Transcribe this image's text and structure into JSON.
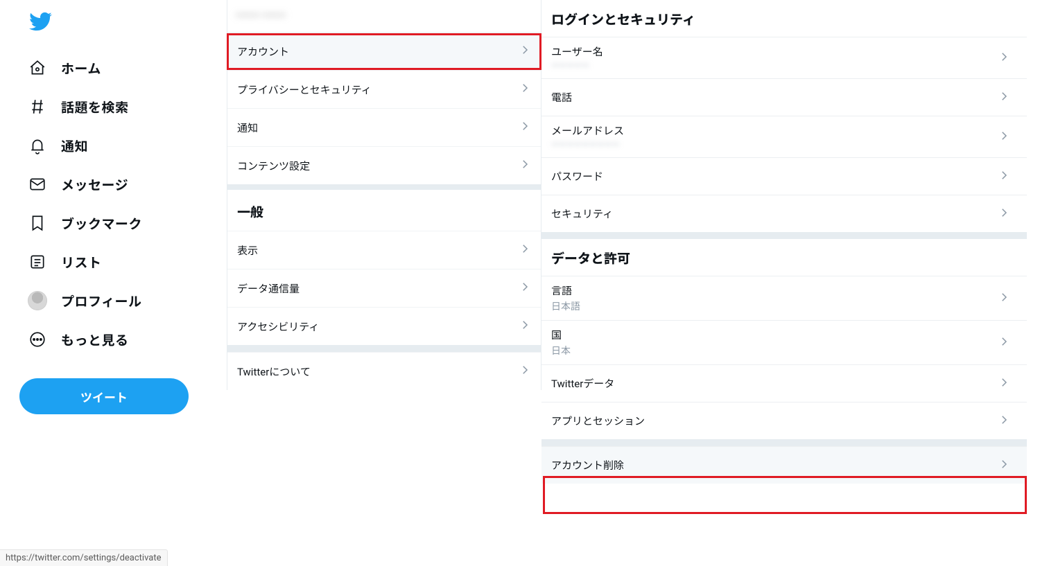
{
  "nav": {
    "items": [
      {
        "name": "home",
        "label": "ホーム"
      },
      {
        "name": "explore",
        "label": "話題を検索"
      },
      {
        "name": "notify",
        "label": "通知"
      },
      {
        "name": "messages",
        "label": "メッセージ"
      },
      {
        "name": "bookmarks",
        "label": "ブックマーク"
      },
      {
        "name": "lists",
        "label": "リスト"
      },
      {
        "name": "profile",
        "label": "プロフィール"
      },
      {
        "name": "more",
        "label": "もっと見る"
      }
    ],
    "tweet": "ツイート"
  },
  "settings": {
    "account_header_value": "———  ———",
    "items1": [
      {
        "name": "account",
        "label": "アカウント"
      },
      {
        "name": "privacy",
        "label": "プライバシーとセキュリティ"
      },
      {
        "name": "notifications",
        "label": "通知"
      },
      {
        "name": "content",
        "label": "コンテンツ設定"
      }
    ],
    "section_general": "一般",
    "items2": [
      {
        "name": "display",
        "label": "表示"
      },
      {
        "name": "data",
        "label": "データ通信量"
      },
      {
        "name": "accessibility",
        "label": "アクセシビリティ"
      },
      {
        "name": "about",
        "label": "Twitterについて"
      }
    ]
  },
  "right": {
    "section_login": "ログインとセキュリティ",
    "login_items": [
      {
        "name": "username",
        "label": "ユーザー名",
        "sub": "—————",
        "blur": true
      },
      {
        "name": "phone",
        "label": "電話"
      },
      {
        "name": "email",
        "label": "メールアドレス",
        "sub": "—————————",
        "blur": true
      },
      {
        "name": "password",
        "label": "パスワード"
      },
      {
        "name": "security",
        "label": "セキュリティ"
      }
    ],
    "section_data": "データと許可",
    "data_items": [
      {
        "name": "language",
        "label": "言語",
        "sub": "日本語"
      },
      {
        "name": "country",
        "label": "国",
        "sub": "日本"
      },
      {
        "name": "twdata",
        "label": "Twitterデータ"
      },
      {
        "name": "apps",
        "label": "アプリとセッション"
      }
    ],
    "delete_label": "アカウント削除"
  },
  "status_url": "https://twitter.com/settings/deactivate"
}
